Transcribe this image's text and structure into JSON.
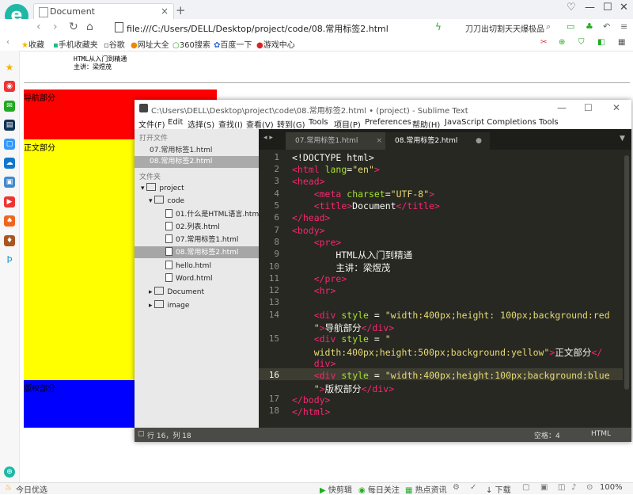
{
  "browser": {
    "tab_title": "Document",
    "url": "file:///C:/Users/DELL/Desktop/project/code/08.常用标签2.html",
    "search_text": "刀刀出切割天天爆极品",
    "bookmarks": [
      "收藏",
      "手机收藏夹",
      "谷歌",
      "网址大全",
      "360搜索",
      "百度一下",
      "游戏中心"
    ]
  },
  "page": {
    "pre_line1": "HTML从入门到精通",
    "pre_line2": "主讲：梁煜茂",
    "nav_label": "导航部分",
    "main_label": "正文部分",
    "copyright_label": "版权部分",
    "colors": {
      "nav": "#ff0000",
      "main": "#ffff00",
      "copyright": "#0000ff"
    }
  },
  "statusbar": {
    "left": "今日优选",
    "items": [
      "快剪辑",
      "每日关注",
      "热点资讯",
      "下载"
    ],
    "zoom": "100%"
  },
  "sublime": {
    "title": "C:\\Users\\DELL\\Desktop\\project\\code\\08.常用标签2.html • (project) - Sublime Text",
    "menu": [
      "文件(F)",
      "Edit",
      "选择(S)",
      "查找(I)",
      "查看(V)",
      "转到(G)",
      "Tools",
      "项目(P)",
      "Preferences",
      "帮助(H)",
      "JavaScript Completions Tools"
    ],
    "open_files_header": "打开文件",
    "open_files": [
      "07.常用标签1.html",
      "08.常用标签2.html"
    ],
    "folders_header": "文件夹",
    "tree": {
      "project": "project",
      "code": "code",
      "files": [
        "01.什么是HTML语言.html",
        "02.列表.html",
        "07.常用标签1.html",
        "08.常用标签2.html",
        "hello.html",
        "Word.html"
      ],
      "folder_document": "Document",
      "folder_image": "image"
    },
    "tabs": [
      "07.常用标签1.html",
      "08.常用标签2.html"
    ],
    "line_numbers": [
      "1",
      "2",
      "3",
      "4",
      "5",
      "6",
      "7",
      "8",
      "9",
      "10",
      "11",
      "12",
      "13",
      "14",
      "15",
      "16",
      "17",
      "18"
    ],
    "code": {
      "l1": "<!DOCTYPE html>",
      "l9": "        HTML从入门到精通",
      "l10": "        主讲：梁煜茂",
      "nav_text": "导航部分",
      "main_text": "正文部分",
      "copy_text": "版权部分"
    },
    "status_left": "行 16，列 18",
    "status_spaces": "空格：4",
    "status_syntax": "HTML"
  }
}
